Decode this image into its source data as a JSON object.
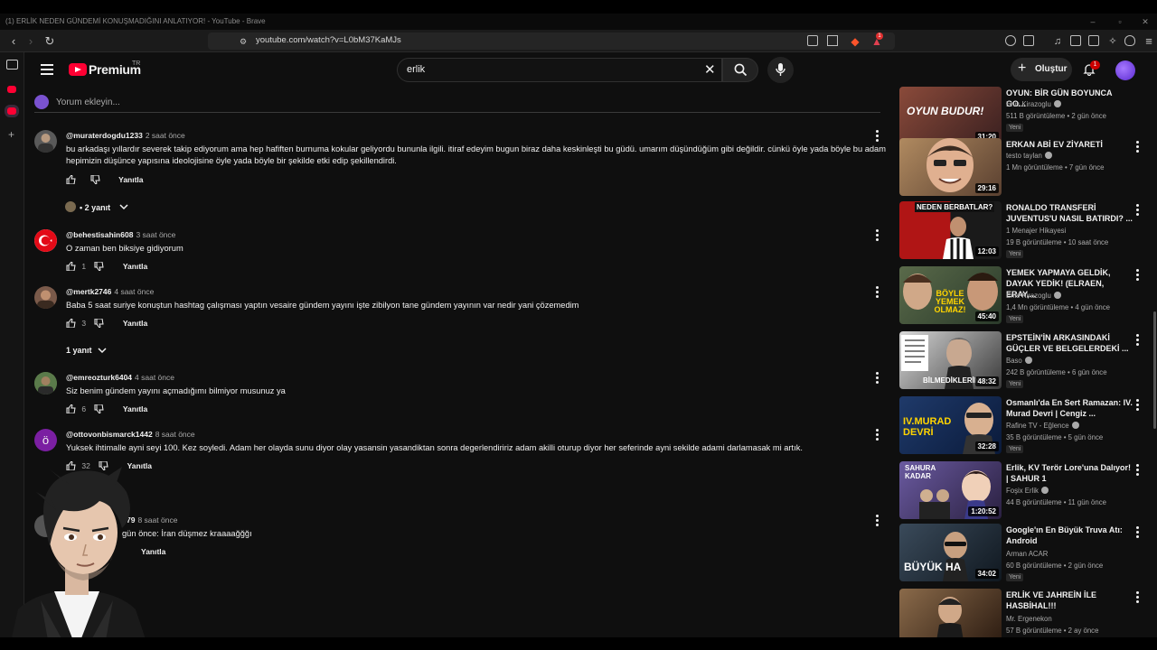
{
  "browser": {
    "window_title": "(1) ERLİK NEDEN GÜNDEMİ KONUŞMADIĞINI ANLATIYOR! - YouTube - Brave",
    "url": "youtube.com/watch?v=L0bM37KaMJs",
    "shield_badge": "1"
  },
  "header": {
    "logo_text": "Premium",
    "logo_suffix": "TR",
    "search_value": "erlik",
    "create_label": "Oluştur",
    "notification_count": "1"
  },
  "comments": {
    "add_placeholder": "Yorum ekleyin...",
    "items": [
      {
        "author": "@muraterdogdu1233",
        "time": "2 saat önce",
        "text": "bu arkadaşı yıllardır severek takip ediyorum ama hep hafiften burnuma kokular geliyordu bununla ilgili. itiraf edeyim bugun biraz daha keskinleşti bu güdü. umarım düşündüğüm gibi değildir. cünkü öyle yada böyle bu adam hepimizin düşünce yapısına ideolojisine öyle yada böyle bir şekilde etki edip şekillendirdi.",
        "likes": "",
        "reply_label": "Yanıtla",
        "replies_label": "• 2 yanıt"
      },
      {
        "author": "@behestisahin608",
        "time": "3 saat önce",
        "text": "O zaman ben biksiye gidiyorum",
        "likes": "1",
        "reply_label": "Yanıtla"
      },
      {
        "author": "@mertk2746",
        "time": "4 saat önce",
        "text": "Baba 5 saat suriye konuştun hashtag çalışması yaptın vesaire gündem yayını işte zibilyon tane gündem yayının var nedir yani çözemedim",
        "likes": "3",
        "reply_label": "Yanıtla",
        "replies_label": "1 yanıt"
      },
      {
        "author": "@emreozturk6404",
        "time": "4 saat önce",
        "text": "Siz benim gündem yayını açmadığımı bilmiyor musunuz ya",
        "likes": "6",
        "reply_label": "Yanıtla"
      },
      {
        "author": "@ottovonbismarck1442",
        "time": "8 saat önce",
        "avatar_letter": "ö",
        "text": "Yuksek ihtimalle ayni seyi 100. Kez soyledi. Adam her olayda sunu diyor olay yasansin yasandiktan sonra degerlendiririz adam akilli oturup diyor her seferinde ayni sekilde adami darlamasak mi artık.",
        "likes": "32",
        "reply_label": "Yanıtla"
      },
      {
        "author": "79",
        "time": "8 saat önce",
        "text": "gün önce: İran düşmez kraaaağğğı",
        "likes": "",
        "reply_label": "Yanıtla"
      }
    ]
  },
  "recommendations": [
    {
      "title": "OYUN: BİR GÜN BOYUNCA GO...",
      "channel": "Enis Kirazoglu",
      "verified": true,
      "meta": "511 B görüntüleme • 2 gün önce",
      "badge": "Yeni",
      "duration": "31:20",
      "thumb_text": "OYUN BUDUR!",
      "thumb_color": "#6b3a2a"
    },
    {
      "title": "ERKAN ABİ EV ZİYARETİ",
      "channel": "testo taylan",
      "verified": true,
      "meta": "1 Mn görüntüleme • 7 gün önce",
      "badge": "",
      "duration": "29:16",
      "thumb_text": "",
      "thumb_color": "#8a6a50"
    },
    {
      "title": "RONALDO TRANSFERİ JUVENTUS'U NASIL BATIRDI? ...",
      "channel": "1 Menajer Hikayesi",
      "verified": false,
      "meta": "19 B görüntüleme • 10 saat önce",
      "badge": "Yeni",
      "duration": "12:03",
      "thumb_text": "NEDEN BERBATLAR?",
      "thumb_color": "#b01515"
    },
    {
      "title": "YEMEK YAPMAYA GELDİK, DAYAK YEDİK! (ELRAEN, ERAY,...",
      "channel": "Enis Kirazoglu",
      "verified": true,
      "meta": "1,4 Mn görüntüleme • 4 gün önce",
      "badge": "Yeni",
      "duration": "45:40",
      "thumb_text": "BÖYLE YEMEK OLMAZ!",
      "thumb_color": "#4a5a3a"
    },
    {
      "title": "EPSTEİN'İN ARKASINDAKİ GÜÇLER VE BELGELERDEKİ ...",
      "channel": "Baso",
      "verified": true,
      "meta": "242 B görüntüleme • 6 gün önce",
      "badge": "Yeni",
      "duration": "48:32",
      "thumb_text": "BİLMEDİKLERİN",
      "thumb_color": "#3a3a3a"
    },
    {
      "title": "Osmanlı'da En Sert Ramazan: IV. Murad Devri | Cengiz ...",
      "channel": "Rafine TV - Eğlence",
      "verified": true,
      "meta": "35 B görüntüleme • 5 gün önce",
      "badge": "Yeni",
      "duration": "32:28",
      "thumb_text": "IV.MURAD DEVRİ",
      "thumb_color": "#1f3a6a"
    },
    {
      "title": "Erlik, KV Terör Lore'una Dalıyor! | SAHUR 1",
      "channel": "Foşix Erlik",
      "verified": true,
      "meta": "44 B görüntüleme • 11 gün önce",
      "badge": "",
      "duration": "1:20:52",
      "thumb_text": "SAHURA KADAR",
      "thumb_color": "#5a4a8a"
    },
    {
      "title": "Google'ın En Büyük Truva Atı: Android",
      "channel": "Arman ACAR",
      "verified": false,
      "meta": "60 B görüntüleme • 2 gün önce",
      "badge": "Yeni",
      "duration": "34:02",
      "thumb_text": "BÜYÜK HA",
      "thumb_color": "#2a3a4a"
    },
    {
      "title": "ERLİK VE JAHREİN İLE HASBİHAL!!!",
      "channel": "Mr. Ergenekon",
      "verified": false,
      "meta": "57 B görüntüleme • 2 ay önce",
      "badge": "",
      "duration": "",
      "thumb_text": "",
      "thumb_color": "#6a4a2a"
    }
  ]
}
